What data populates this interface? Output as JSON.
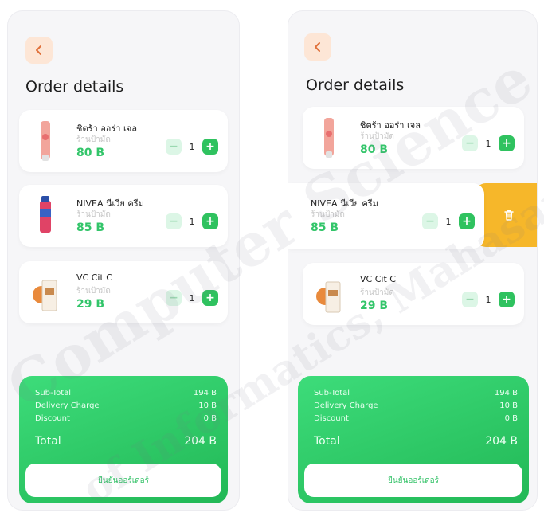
{
  "app": {
    "title": "Order details"
  },
  "screens": [
    {
      "items": [
        {
          "name": "ชิตร้า ออร่า เจล",
          "shop": "ร้านป้ามัด",
          "price": "80 B",
          "qty": "1",
          "minus": "−",
          "plus": "+"
        },
        {
          "name": "NIVEA นีเวีย ครีม",
          "shop": "ร้านป้ามัด",
          "price": "85 B",
          "qty": "1",
          "minus": "−",
          "plus": "+"
        },
        {
          "name": "VC Cit C",
          "shop": "ร้านป้ามัด",
          "price": "29 B",
          "qty": "1",
          "minus": "−",
          "plus": "+"
        }
      ],
      "summary": {
        "subtotal_label": "Sub-Total",
        "subtotal_value": "194 B",
        "delivery_label": "Delivery Charge",
        "delivery_value": "10 B",
        "discount_label": "Discount",
        "discount_value": "0 B",
        "total_label": "Total",
        "total_value": "204 B",
        "confirm_label": "ยืนยันออร์เดอร์"
      }
    },
    {
      "items": [
        {
          "name": "ชิตร้า ออร่า เจล",
          "shop": "ร้านป้ามัด",
          "price": "80 B",
          "qty": "1",
          "minus": "−",
          "plus": "+"
        },
        {
          "name": "NIVEA นีเวีย ครีม",
          "shop": "ร้านป้ามัด",
          "price": "85 B",
          "qty": "1",
          "minus": "−",
          "plus": "+"
        },
        {
          "name": "VC Cit C",
          "shop": "ร้านป้ามัด",
          "price": "29 B",
          "qty": "1",
          "minus": "−",
          "plus": "+"
        }
      ],
      "summary": {
        "subtotal_label": "Sub-Total",
        "subtotal_value": "194 B",
        "delivery_label": "Delivery Charge",
        "delivery_value": "10 B",
        "discount_label": "Discount",
        "discount_value": "0 B",
        "total_label": "Total",
        "total_value": "204 B",
        "confirm_label": "ยืนยันออร์เดอร์"
      }
    }
  ],
  "icons": {
    "back": "chevron-left-icon",
    "delete": "trash-icon"
  },
  "watermark": {
    "line1": "Computer Science",
    "line2": "of Informatics, Mahasarakham"
  },
  "colors": {
    "accent_green": "#2fc25f",
    "price_green": "#33c56a",
    "back_bg": "#fde6d6",
    "delete_orange": "#f6b72a"
  }
}
